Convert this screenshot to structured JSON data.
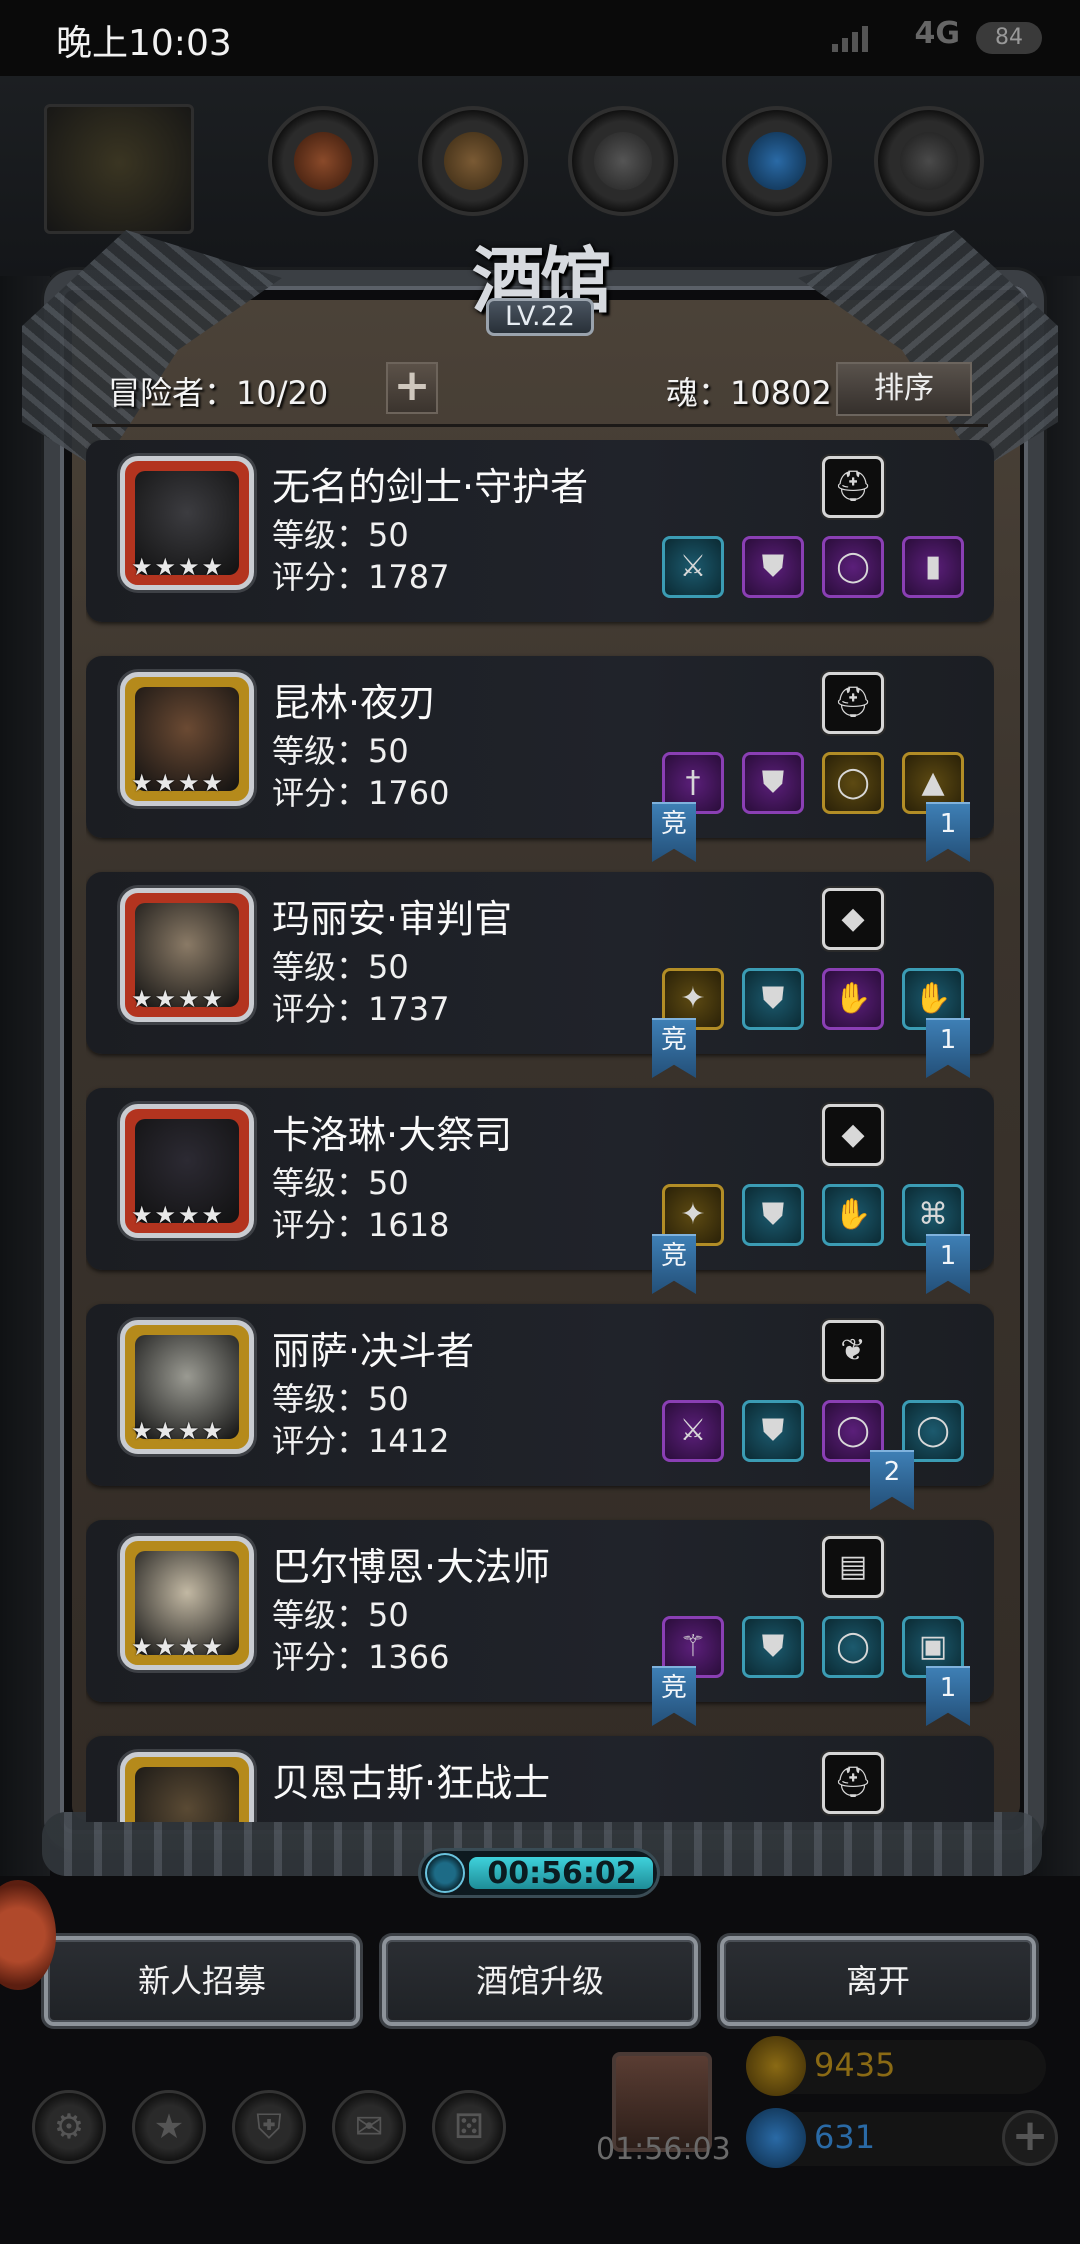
{
  "status_bar": {
    "time": "晚上10:03",
    "network": "4G",
    "battery": "84"
  },
  "tavern": {
    "title": "酒馆",
    "level": "LV.22",
    "adventurers_text": "冒险者：10/20",
    "soul_text": "魂：10802",
    "sort_label": "排序",
    "timer": "00:56:02"
  },
  "heroes": [
    {
      "name": "无名的剑士·守护者",
      "level": "等级：50",
      "score": "评分：1787",
      "stars": "★★★★",
      "frame": "red",
      "slot_icon": "helmet-icon",
      "equip": [
        "sword-icon",
        "armor-icon",
        "ring-icon",
        "shield-icon"
      ],
      "equip_rarity": [
        "blue",
        "purple",
        "purple",
        "purple"
      ],
      "badge_left": "",
      "badge_right": ""
    },
    {
      "name": "昆林·夜刃",
      "level": "等级：50",
      "score": "评分：1760",
      "stars": "★★★★",
      "frame": "gold",
      "slot_icon": "helmet-icon",
      "equip": [
        "dagger-icon",
        "armor-icon",
        "ring-icon",
        "cloak-icon"
      ],
      "equip_rarity": [
        "purple",
        "purple",
        "gold",
        "gold"
      ],
      "badge_left": "竞",
      "badge_right": "1"
    },
    {
      "name": "玛丽安·审判官",
      "level": "等级：50",
      "score": "评分：1737",
      "stars": "★★★★",
      "frame": "red",
      "slot_icon": "crystal-icon",
      "equip": [
        "mace-icon",
        "armor-icon",
        "gauntlet-icon",
        "gauntlet-icon"
      ],
      "equip_rarity": [
        "gold",
        "blue",
        "purple",
        "blue"
      ],
      "badge_left": "竞",
      "badge_right": "1"
    },
    {
      "name": "卡洛琳·大祭司",
      "level": "等级：50",
      "score": "评分：1618",
      "stars": "★★★★",
      "frame": "red",
      "slot_icon": "crystal-icon",
      "equip": [
        "mace-icon",
        "armor-icon",
        "gauntlet-icon",
        "amulet-icon"
      ],
      "equip_rarity": [
        "gold",
        "blue",
        "blue",
        "blue"
      ],
      "badge_left": "竞",
      "badge_right": "1"
    },
    {
      "name": "丽萨·决斗者",
      "level": "等级：50",
      "score": "评分：1412",
      "stars": "★★★★",
      "frame": "gold",
      "slot_icon": "feather-icon",
      "equip": [
        "sword-icon",
        "armor-icon",
        "ring-icon",
        "ring-icon"
      ],
      "equip_rarity": [
        "purple",
        "blue",
        "purple",
        "blue"
      ],
      "badge_left": "",
      "badge_right": "2"
    },
    {
      "name": "巴尔博恩·大法师",
      "level": "等级：50",
      "score": "评分：1366",
      "stars": "★★★★",
      "frame": "gold",
      "slot_icon": "spellbook-icon",
      "equip": [
        "staff-icon",
        "armor-icon",
        "ring-icon",
        "chest-icon"
      ],
      "equip_rarity": [
        "purple",
        "blue",
        "blue",
        "blue"
      ],
      "badge_left": "竞",
      "badge_right": "1"
    },
    {
      "name": "贝恩古斯·狂战士",
      "level": "",
      "score": "",
      "stars": "",
      "frame": "gold",
      "slot_icon": "helmet-icon",
      "equip": [],
      "equip_rarity": [],
      "badge_left": "",
      "badge_right": ""
    }
  ],
  "actions": {
    "recruit": "新人招募",
    "upgrade": "酒馆升级",
    "leave": "离开"
  },
  "bottom_bar": {
    "gift_timer": "01:56:03",
    "gold": "9435",
    "gems": "631",
    "gold_color": "#8a6a14",
    "gem_color": "#2a6aa6",
    "icons": [
      "gear-icon",
      "star-icon",
      "helm-icon",
      "mail-icon",
      "dice-icon"
    ]
  }
}
